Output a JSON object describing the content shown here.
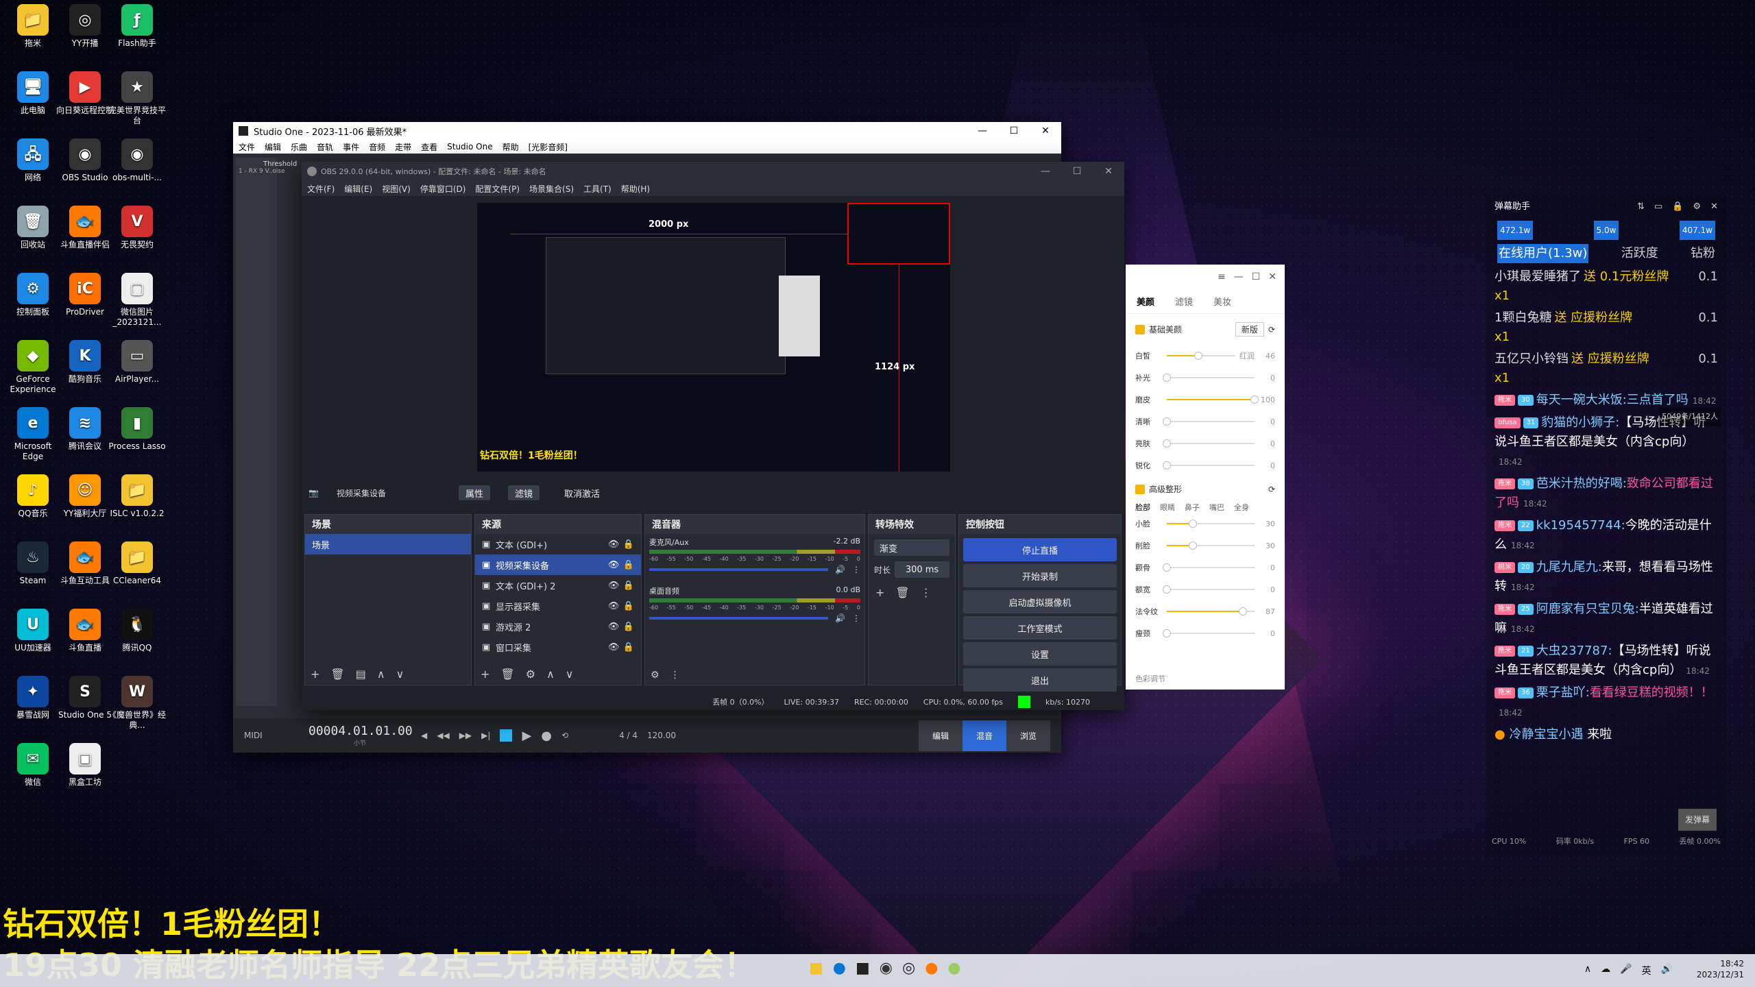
{
  "desktop_icons": [
    {
      "label": "拖米",
      "color": "#f4c430",
      "glyph": "📁"
    },
    {
      "label": "YY开播",
      "color": "#222",
      "glyph": "◎"
    },
    {
      "label": "Flash助手",
      "color": "#1bbf66",
      "glyph": "ƒ"
    },
    {
      "label": "此电脑",
      "color": "#1e88e5",
      "glyph": "🖥"
    },
    {
      "label": "向日葵远程控制",
      "color": "#e53935",
      "glyph": "▶"
    },
    {
      "label": "完美世界竞技平台",
      "color": "#444",
      "glyph": "★"
    },
    {
      "label": "网络",
      "color": "#1e88e5",
      "glyph": "🖧"
    },
    {
      "label": "OBS Studio",
      "color": "#333",
      "glyph": "◉"
    },
    {
      "label": "obs-multi-...",
      "color": "#333",
      "glyph": "◉"
    },
    {
      "label": "回收站",
      "color": "#90a4ae",
      "glyph": "🗑"
    },
    {
      "label": "斗鱼直播伴侣",
      "color": "#ff7a00",
      "glyph": "🐟"
    },
    {
      "label": "无畏契约",
      "color": "#d32f2f",
      "glyph": "V"
    },
    {
      "label": "控制面板",
      "color": "#1e88e5",
      "glyph": "⚙"
    },
    {
      "label": "ProDriver",
      "color": "#ff6f00",
      "glyph": "iC"
    },
    {
      "label": "微信图片_2023121...",
      "color": "#eee",
      "glyph": "▢"
    },
    {
      "label": "GeForce Experience",
      "color": "#76b900",
      "glyph": "◆"
    },
    {
      "label": "酷狗音乐",
      "color": "#1565c0",
      "glyph": "K"
    },
    {
      "label": "AirPlayer...",
      "color": "#555",
      "glyph": "▭"
    },
    {
      "label": "Microsoft Edge",
      "color": "#0078d4",
      "glyph": "e"
    },
    {
      "label": "腾讯会议",
      "color": "#1e88e5",
      "glyph": "≋"
    },
    {
      "label": "Process Lasso",
      "color": "#2e7d32",
      "glyph": "▮"
    },
    {
      "label": "QQ音乐",
      "color": "#ffd600",
      "glyph": "♪"
    },
    {
      "label": "YY福利大厅",
      "color": "#ff9800",
      "glyph": "☺"
    },
    {
      "label": "ISLC v1.0.2.2",
      "color": "#f4c430",
      "glyph": "📁"
    },
    {
      "label": "Steam",
      "color": "#1b2838",
      "glyph": "♨"
    },
    {
      "label": "斗鱼互动工具",
      "color": "#ff7a00",
      "glyph": "🐟"
    },
    {
      "label": "CCleaner64",
      "color": "#f4c430",
      "glyph": "📁"
    },
    {
      "label": "UU加速器",
      "color": "#00bcd4",
      "glyph": "U"
    },
    {
      "label": "斗鱼直播",
      "color": "#ff7a00",
      "glyph": "🐟"
    },
    {
      "label": "腾讯QQ",
      "color": "#111",
      "glyph": "🐧"
    },
    {
      "label": "暴雪战网",
      "color": "#0d47a1",
      "glyph": "✦"
    },
    {
      "label": "Studio One 5",
      "color": "#222",
      "glyph": "S"
    },
    {
      "label": "《魔兽世界》经典...",
      "color": "#4e342e",
      "glyph": "W"
    },
    {
      "label": "微信",
      "color": "#07c160",
      "glyph": "✉"
    },
    {
      "label": "黑盒工坊",
      "color": "#eee",
      "glyph": "▣"
    }
  ],
  "studio_one": {
    "title": "Studio One - 2023-11-06  最新效果*",
    "menu": [
      "文件",
      "编辑",
      "乐曲",
      "音轨",
      "事件",
      "音频",
      "走带",
      "查看",
      "Studio One",
      "帮助",
      "[光影音频]"
    ],
    "track_name": "Threshold",
    "track_sub": "1 - RX 9 V..oise",
    "position": "00004.01.01.00",
    "position_sub": "小节",
    "meter": "4 / 4",
    "tempo": "120.00",
    "tabs": [
      "编辑",
      "混音",
      "浏览"
    ],
    "active_tab": "混音"
  },
  "obs": {
    "title": "OBS 29.0.0 (64-bit, windows) - 配置文件: 未命名 - 场景: 未命名",
    "menu": [
      "文件(F)",
      "编辑(E)",
      "视图(V)",
      "停靠窗口(D)",
      "配置文件(P)",
      "场景集合(S)",
      "工具(T)",
      "帮助(H)"
    ],
    "preview_labels": {
      "width": "2000 px",
      "height": "1124 px",
      "caption": "钻石双倍！1毛粉丝团！"
    },
    "source_bar": {
      "source": "视频采集设备",
      "props": "属性",
      "filters": "滤镜",
      "deactivate": "取消激活"
    },
    "scenes": {
      "title": "场景",
      "items": [
        "场景"
      ]
    },
    "sources": {
      "title": "来源",
      "items": [
        "文本 (GDI+)",
        "视频采集设备",
        "文本 (GDI+) 2",
        "显示器采集",
        "游戏源 2",
        "窗口采集"
      ]
    },
    "mixer": {
      "title": "混音器",
      "channels": [
        {
          "name": "麦克风/Aux",
          "db": "-2.2 dB"
        },
        {
          "name": "桌面音频",
          "db": "0.0 dB"
        }
      ],
      "ticks": [
        "-60",
        "-55",
        "-50",
        "-45",
        "-40",
        "-35",
        "-30",
        "-25",
        "-20",
        "-15",
        "-10",
        "-5",
        "0"
      ]
    },
    "transitions": {
      "title": "转场特效",
      "type": "渐变",
      "duration_label": "时长",
      "duration": "300 ms"
    },
    "controls": {
      "title": "控制按钮",
      "buttons": [
        "停止直播",
        "开始录制",
        "启动虚拟摄像机",
        "工作室模式",
        "设置",
        "退出"
      ]
    },
    "status": {
      "dropped": "丢帧 0（0.0%）",
      "live": "LIVE: 00:39:37",
      "rec": "REC: 00:00:00",
      "cpu": "CPU: 0.0%, 60.00 fps",
      "kbs": "kb/s: 10270"
    }
  },
  "beauty": {
    "tabs": [
      "美颜",
      "滤镜",
      "美妆"
    ],
    "basic_label": "基础美颜",
    "version": "新版",
    "basic_sliders": [
      {
        "name": "白皙",
        "extra": "红润",
        "value": "46"
      },
      {
        "name": "补光",
        "value": "0"
      },
      {
        "name": "磨皮",
        "value": "100"
      },
      {
        "name": "清晰",
        "value": "0"
      },
      {
        "name": "亮肤",
        "value": "0"
      },
      {
        "name": "锐化",
        "value": "0"
      }
    ],
    "advanced_label": "高级整形",
    "adv_tabs": [
      "脸部",
      "眼睛",
      "鼻子",
      "嘴巴",
      "全身"
    ],
    "adv_sliders": [
      {
        "name": "小脸",
        "value": "30"
      },
      {
        "name": "削脸",
        "value": "30"
      },
      {
        "name": "颧骨",
        "value": "0"
      },
      {
        "name": "额宽",
        "value": "0"
      },
      {
        "name": "法令纹",
        "value": "87"
      },
      {
        "name": "瘦颈",
        "value": "0"
      }
    ],
    "footer": "色彩调节",
    "basic_levels": [
      0.46,
      0,
      1,
      0,
      0,
      0
    ],
    "adv_levels": [
      0.3,
      0.3,
      0,
      0,
      0.87,
      0
    ]
  },
  "danmaku": {
    "title": "弹幕助手",
    "stats": [
      "472.1w",
      "5.0w",
      "407.1w"
    ],
    "tabs": [
      "在线用户(1.3w)",
      "活跃度",
      "钻粉"
    ],
    "counter": "5049条/1412人",
    "gift_msgs": [
      {
        "user": "小琪最爱睡猪了",
        "gift": "送 0.1元粉丝牌",
        "count": "x1",
        "value": "0.1"
      },
      {
        "user": "1颗白兔糖",
        "gift": "送 应援粉丝牌",
        "count": "x1",
        "value": "0.1"
      },
      {
        "user": "五亿只小铃铛",
        "gift": "送 应援粉丝牌",
        "count": "x1",
        "value": "0.1"
      }
    ],
    "chat_msgs": [
      {
        "badge": "拖米",
        "level": "30",
        "user": "每天一碗大米饭:",
        "text": "三点首了吗",
        "time": "18:42",
        "color": "blue"
      },
      {
        "badge": "bfusa",
        "level": "31",
        "user": "豹猫的小狮子:",
        "text": "【马场性转】听说斗鱼王者区都是美女（内含cp向）",
        "time": "18:42",
        "color": "white"
      },
      {
        "badge": "拖米",
        "level": "38",
        "user": "芭米汁热的好喝:",
        "text": "致命公司都看过了吗",
        "time": "18:42",
        "color": "pink"
      },
      {
        "badge": "拖米",
        "level": "22",
        "user": "kk195457744:",
        "text": "今晚的活动是什么",
        "time": "18:42",
        "color": "white"
      },
      {
        "badge": "桃米",
        "level": "20",
        "user": "九尾九尾九:",
        "text": "来哥，想看看马场性转",
        "time": "18:42",
        "color": "white"
      },
      {
        "badge": "拖米",
        "level": "25",
        "user": "阿鹿家有只宝贝兔:",
        "text": "半道英雄看过嘛",
        "time": "18:42",
        "color": "white"
      },
      {
        "badge": "拖米",
        "level": "21",
        "user": "大虫237787:",
        "text": "【马场性转】听说斗鱼王者区都是美女（内含cp向）",
        "time": "18:42",
        "color": "white"
      },
      {
        "badge": "拖米",
        "level": "36",
        "user": "栗子盐吖:",
        "text": "看看绿豆糕的视频！！",
        "time": "18:42",
        "color": "pink"
      }
    ],
    "enter_msg": {
      "user": "冷静宝宝小遇",
      "text": "来啦"
    },
    "send_btn": "发弹幕",
    "footer": [
      "CPU 10%",
      "码率 0kb/s",
      "FPS 60",
      "丢帧 0.00%"
    ]
  },
  "overlay": {
    "line1": "钻石双倍！1毛粉丝团！",
    "line2": "19点30 清融老师名师指导 22点三兄弟精英歌友会！"
  },
  "taskbar": {
    "time": "18:42",
    "date": "2023/12/31",
    "ime": "英"
  }
}
